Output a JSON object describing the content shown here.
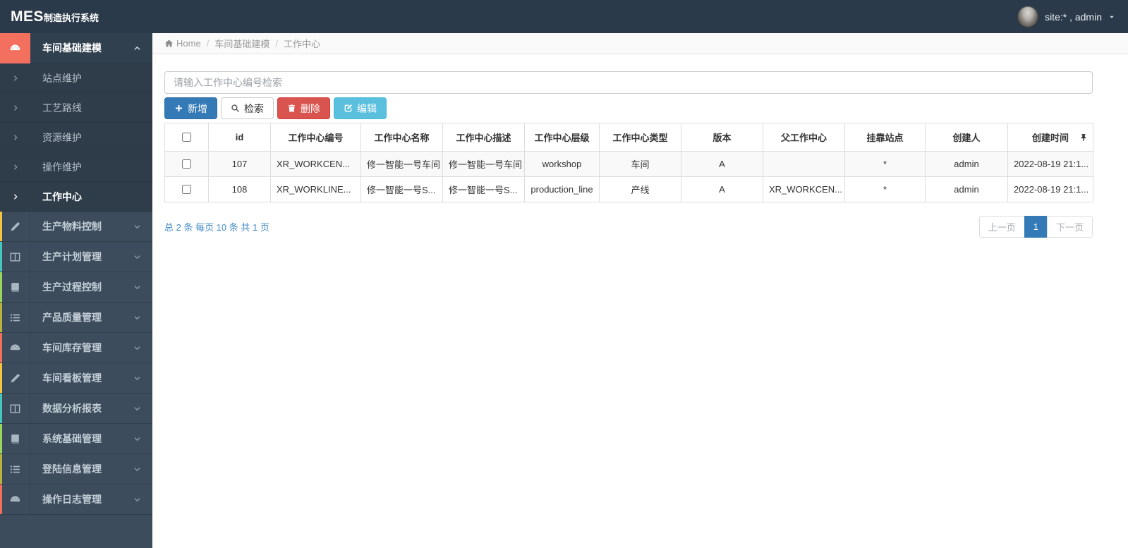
{
  "navbar": {
    "brand_bold": "MES",
    "brand_rest": "制造执行系统",
    "user": "site:* , admin",
    "avatar": "user-avatar",
    "caret_icon": "caret-down-icon"
  },
  "sidebar": {
    "groups": [
      {
        "label": "车间基础建模",
        "icon": "gauge-icon",
        "color": "#f4705e",
        "active": true,
        "expanded": true,
        "children": [
          {
            "label": "站点维护",
            "active": false
          },
          {
            "label": "工艺路线",
            "active": false
          },
          {
            "label": "资源维护",
            "active": false
          },
          {
            "label": "操作维护",
            "active": false
          },
          {
            "label": "工作中心",
            "active": true
          }
        ]
      },
      {
        "label": "生产物料控制",
        "icon": "pencil-icon",
        "color": "#f5c542",
        "active": false,
        "expanded": false
      },
      {
        "label": "生产计划管理",
        "icon": "columns-icon",
        "color": "#45c8bc",
        "active": false,
        "expanded": false
      },
      {
        "label": "生产过程控制",
        "icon": "book-icon",
        "color": "#98d65e",
        "active": false,
        "expanded": false
      },
      {
        "label": "产品质量管理",
        "icon": "list-icon",
        "color": "#b8b33c",
        "active": false,
        "expanded": false
      },
      {
        "label": "车间库存管理",
        "icon": "gauge-icon",
        "color": "#f4705e",
        "active": false,
        "expanded": false
      },
      {
        "label": "车间看板管理",
        "icon": "pencil-icon",
        "color": "#f5c542",
        "active": false,
        "expanded": false
      },
      {
        "label": "数据分析报表",
        "icon": "columns-icon",
        "color": "#45c8bc",
        "active": false,
        "expanded": false
      },
      {
        "label": "系统基础管理",
        "icon": "book-icon",
        "color": "#98d65e",
        "active": false,
        "expanded": false
      },
      {
        "label": "登陆信息管理",
        "icon": "list-icon",
        "color": "#b8b33c",
        "active": false,
        "expanded": false
      },
      {
        "label": "操作日志管理",
        "icon": "gauge-icon",
        "color": "#f4705e",
        "active": false,
        "expanded": false
      }
    ]
  },
  "breadcrumb": {
    "home_icon": "home-icon",
    "separator": "/",
    "items": [
      "Home",
      "车间基础建模",
      "工作中心"
    ]
  },
  "search": {
    "placeholder": "请输入工作中心编号检索",
    "value": ""
  },
  "toolbar": {
    "buttons": [
      {
        "name": "add-button",
        "label": "新增",
        "icon": "plus-icon",
        "style": "primary"
      },
      {
        "name": "search-button",
        "label": "检索",
        "icon": "search-icon",
        "style": "default"
      },
      {
        "name": "delete-button",
        "label": "删除",
        "icon": "trash-icon",
        "style": "danger"
      },
      {
        "name": "edit-button",
        "label": "编辑",
        "icon": "edit-icon",
        "style": "info"
      }
    ]
  },
  "table": {
    "pin_icon": "pin-icon",
    "columns": [
      "id",
      "工作中心编号",
      "工作中心名称",
      "工作中心描述",
      "工作中心层级",
      "工作中心类型",
      "版本",
      "父工作中心",
      "挂靠站点",
      "创建人",
      "创建时间"
    ],
    "rows": [
      {
        "checked": false,
        "cells": [
          "107",
          "XR_WORKCEN...",
          "修一智能一号车间",
          "修一智能一号车间",
          "workshop",
          "车间",
          "A",
          "",
          "*",
          "admin",
          "2022-08-19 21:1..."
        ]
      },
      {
        "checked": false,
        "cells": [
          "108",
          "XR_WORKLINE...",
          "修一智能一号S...",
          "修一智能一号S...",
          "production_line",
          "产线",
          "A",
          "XR_WORKCEN...",
          "*",
          "admin",
          "2022-08-19 21:1..."
        ]
      }
    ]
  },
  "pagination": {
    "summary": "总 2 条 每页 10 条 共 1 页",
    "prev": "上一页",
    "pages": [
      "1"
    ],
    "active_page": "1",
    "next": "下一页"
  },
  "colors": {
    "navbar_bg": "#2b3a4a",
    "sidebar_bg": "#3c4c5c",
    "submenu_bg": "#2f3d4b",
    "accent_red": "#f4705e",
    "primary": "#337ab7",
    "danger": "#d9534f",
    "info": "#5bc0de",
    "pagination_link": "#418bca",
    "table_border": "#ddd",
    "stripe_row": "#f9f9f9"
  }
}
